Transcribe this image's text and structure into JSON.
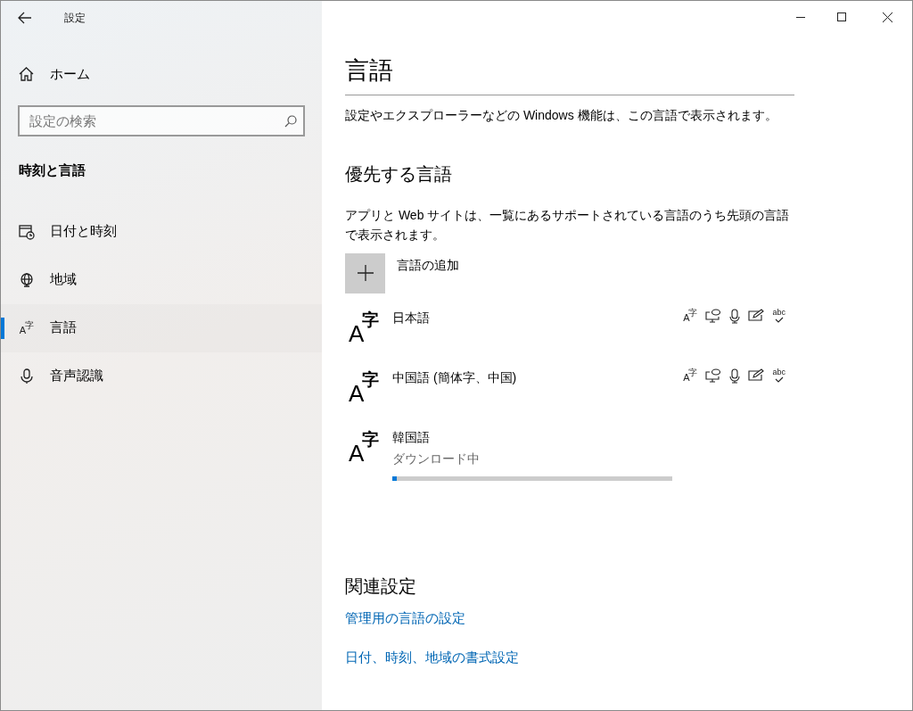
{
  "window": {
    "title": "設定"
  },
  "sidebar": {
    "home": "ホーム",
    "search": {
      "placeholder": "設定の検索"
    },
    "section_title": "時刻と言語",
    "items": [
      {
        "kind": "calendar",
        "label": "日付と時刻",
        "selected": false
      },
      {
        "kind": "globe",
        "label": "地域",
        "selected": false
      },
      {
        "kind": "language",
        "label": "言語",
        "selected": true,
        "glyphs": [
          "A",
          "字"
        ]
      },
      {
        "kind": "microphone",
        "label": "音声認識",
        "selected": false
      }
    ]
  },
  "page": {
    "title": "言語",
    "description": "設定やエクスプローラーなどの Windows 機能は、この言語で表示されます。",
    "preferred": {
      "heading": "優先する言語",
      "description": "アプリと Web サイトは、一覧にあるサポートされている言語のうち先頭の言語で表示されます。",
      "add_button": "言語の追加",
      "languages": [
        {
          "name": "日本語",
          "glyphs": [
            "A",
            "字"
          ],
          "features": [
            {
              "kind": "language-pack",
              "glyphs": [
                "A",
                "字"
              ]
            },
            {
              "kind": "speech"
            },
            {
              "kind": "microphone"
            },
            {
              "kind": "handwriting"
            },
            {
              "kind": "spellcheck",
              "glyph": "abc"
            }
          ]
        },
        {
          "name": "中国語 (簡体字、中国)",
          "glyphs": [
            "A",
            "字"
          ],
          "features": [
            {
              "kind": "language-pack",
              "glyphs": [
                "A",
                "字"
              ]
            },
            {
              "kind": "speech"
            },
            {
              "kind": "microphone"
            },
            {
              "kind": "handwriting"
            },
            {
              "kind": "spellcheck",
              "glyph": "abc"
            }
          ]
        },
        {
          "name": "韓国語",
          "glyphs": [
            "A",
            "字"
          ],
          "status": "ダウンロード中",
          "level": 0.015
        }
      ]
    },
    "related": {
      "heading": "関連設定",
      "links": [
        "管理用の言語の設定",
        "日付、時刻、地域の書式設定"
      ]
    }
  }
}
